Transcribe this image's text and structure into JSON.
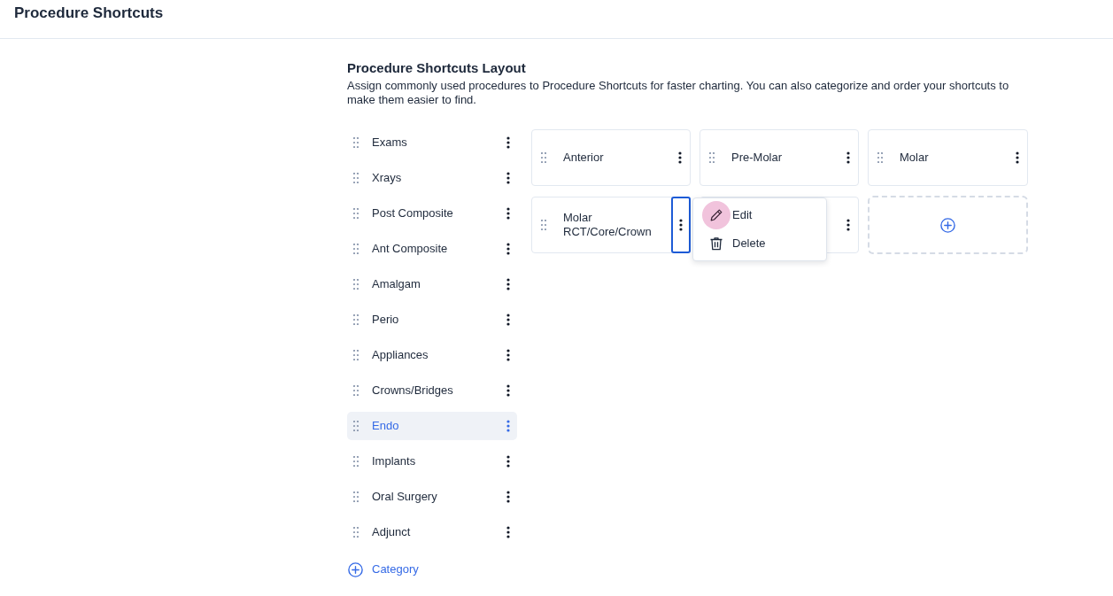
{
  "header": {
    "title": "Procedure Shortcuts"
  },
  "layout": {
    "heading": "Procedure Shortcuts Layout",
    "description": "Assign commonly used procedures to Procedure Shortcuts for faster charting. You can also categorize and order your shortcuts to make them easier to find."
  },
  "categories": [
    {
      "label": "Exams",
      "selected": false
    },
    {
      "label": "Xrays",
      "selected": false
    },
    {
      "label": "Post Composite",
      "selected": false
    },
    {
      "label": "Ant Composite",
      "selected": false
    },
    {
      "label": "Amalgam",
      "selected": false
    },
    {
      "label": "Perio",
      "selected": false
    },
    {
      "label": "Appliances",
      "selected": false
    },
    {
      "label": "Crowns/Bridges",
      "selected": false
    },
    {
      "label": "Endo",
      "selected": true
    },
    {
      "label": "Implants",
      "selected": false
    },
    {
      "label": "Oral Surgery",
      "selected": false
    },
    {
      "label": "Adjunct",
      "selected": false
    }
  ],
  "add_category": {
    "label": "Category"
  },
  "shortcuts": [
    {
      "kind": "card",
      "label": "Anterior",
      "menu_focused": false
    },
    {
      "kind": "card",
      "label": "Pre-Molar",
      "menu_focused": false
    },
    {
      "kind": "card",
      "label": "Molar",
      "menu_focused": false
    },
    {
      "kind": "card",
      "label": "Molar RCT/Core/Crown",
      "menu_focused": true
    },
    {
      "kind": "covered",
      "menu_focused": false
    },
    {
      "kind": "add"
    }
  ],
  "context_menu": {
    "items": [
      {
        "kind": "edit",
        "label": "Edit",
        "hovered": true
      },
      {
        "kind": "delete",
        "label": "Delete",
        "hovered": false
      }
    ]
  }
}
